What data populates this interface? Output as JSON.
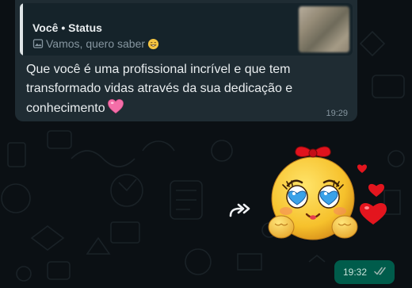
{
  "chat": {
    "quoted": {
      "author": "Você",
      "source": "Status",
      "caption": "Vamos, quero saber",
      "caption_emoji": "grinning-face-emoji",
      "thumbnail": "blurred-status-photo"
    },
    "message": {
      "text": "Que você é uma profissional incrível e que tem transformado vidas através da sua dedicação e conhecimento",
      "emoji": "pink-heart-emoji",
      "time": "19:29"
    },
    "forward_icon": "forward-arrow-icon",
    "sticker": {
      "name": "emoji-girl-heart-eyes-sticker",
      "colors": {
        "face": "#f6c12c",
        "bow": "#e0121d",
        "hearts": "#e3151e",
        "eyes": "#3aa2e8"
      }
    },
    "outgoing": {
      "time": "19:32",
      "status_icon": "double-check-icon"
    }
  },
  "colors": {
    "background": "#0b1014",
    "incoming_bubble": "#1f2c33",
    "quote_panel": "#15232a",
    "outgoing_bubble": "#005c4b",
    "text_primary": "#e9edef",
    "text_secondary": "#8696a0"
  }
}
